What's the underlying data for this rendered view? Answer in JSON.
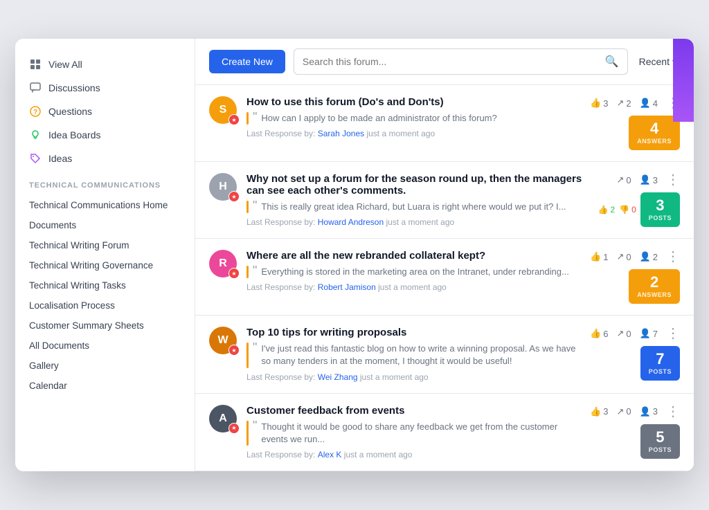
{
  "sidebar": {
    "items": [
      {
        "id": "view-all",
        "label": "View All",
        "icon": "grid"
      },
      {
        "id": "discussions",
        "label": "Discussions",
        "icon": "chat"
      },
      {
        "id": "questions",
        "label": "Questions",
        "icon": "question"
      },
      {
        "id": "idea-boards",
        "label": "Idea Boards",
        "icon": "lightbulb"
      },
      {
        "id": "ideas",
        "label": "Ideas",
        "icon": "tag"
      }
    ],
    "section_label": "TECHNICAL COMMUNICATIONS",
    "nav_items": [
      "Technical Communications Home",
      "Documents",
      "Technical Writing Forum",
      "Technical Writing Governance",
      "Technical Writing Tasks",
      "Localisation Process",
      "Customer Summary Sheets",
      "All Documents",
      "Gallery",
      "Calendar"
    ]
  },
  "topbar": {
    "create_button": "Create New",
    "search_placeholder": "Search this forum...",
    "sort_label": "Recent"
  },
  "posts": [
    {
      "id": "post-1",
      "title": "How to use this forum (Do's and Don'ts)",
      "excerpt": "How can I apply to be made an administrator of this forum?",
      "last_response_by": "Sarah Jones",
      "last_response_time": "just a moment ago",
      "likes": 3,
      "shares": 2,
      "followers": 4,
      "badge_count": 4,
      "badge_label": "ANSWERS",
      "badge_color": "orange",
      "avatar_color": "#f59e0b",
      "avatar_initial": "S"
    },
    {
      "id": "post-2",
      "title": "Why not set up a forum for the season round up, then the managers can see each other's comments.",
      "excerpt": "This is really great idea Richard, but Luara is right where would we put it? I...",
      "last_response_by": "Howard Andreson",
      "last_response_time": "just a moment ago",
      "shares": 0,
      "followers": 3,
      "thumbs_up": 2,
      "thumbs_down": 0,
      "badge_count": 3,
      "badge_label": "POSTS",
      "badge_color": "green",
      "avatar_color": "#6b7280",
      "avatar_initial": "H",
      "has_vote_row": true
    },
    {
      "id": "post-3",
      "title": "Where are all the new rebranded collateral kept?",
      "excerpt": "Everything is stored in the marketing area on the Intranet, under rebranding...",
      "last_response_by": "Robert Jamison",
      "last_response_time": "just a moment ago",
      "likes": 1,
      "shares": 0,
      "followers": 2,
      "badge_count": 2,
      "badge_label": "ANSWERS",
      "badge_color": "orange",
      "avatar_color": "#ec4899",
      "avatar_initial": "R"
    },
    {
      "id": "post-4",
      "title": "Top 10 tips for writing proposals",
      "excerpt": "I've just read this fantastic blog on how to write a winning proposal. As we have so many tenders in at the moment, I thought it would be useful!",
      "last_response_by": "Wei Zhang",
      "last_response_time": "just a moment ago",
      "likes": 6,
      "shares": 0,
      "followers": 7,
      "badge_count": 7,
      "badge_label": "POSTS",
      "badge_color": "blue",
      "avatar_color": "#d97706",
      "avatar_initial": "W"
    },
    {
      "id": "post-5",
      "title": "Customer feedback from events",
      "excerpt": "Thought it would be good to share any feedback we get from the customer events we run...",
      "last_response_by": "Alex K",
      "last_response_time": "just a moment ago",
      "likes": 3,
      "shares": 0,
      "followers": 3,
      "badge_count": 5,
      "badge_label": "POSTS",
      "badge_color": "gray",
      "avatar_color": "#374151",
      "avatar_initial": "A"
    }
  ]
}
